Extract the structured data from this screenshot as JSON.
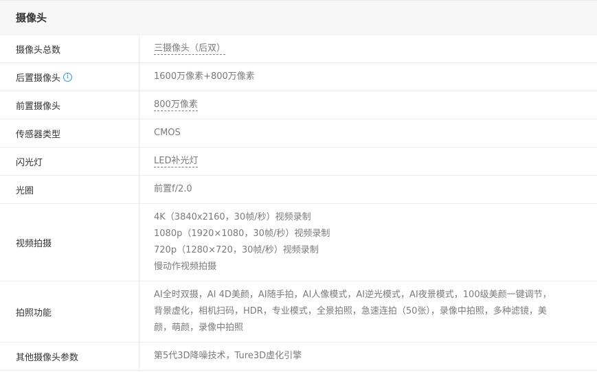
{
  "section": {
    "title": "摄像头"
  },
  "rows": [
    {
      "label": "摄像头总数",
      "value": "三摄像头（后双）"
    },
    {
      "label": "后置摄像头",
      "value": "1600万像素+800万像素",
      "icon": "info-icon"
    },
    {
      "label": "前置摄像头",
      "value": "800万像素"
    },
    {
      "label": "传感器类型",
      "value": "CMOS"
    },
    {
      "label": "闪光灯",
      "value": "LED补光灯"
    },
    {
      "label": "光圈",
      "value": "前置f/2.0"
    },
    {
      "label": "视频拍摄",
      "lines": [
        "4K（3840x2160，30帧/秒）视频录制",
        "1080p（1920×1080，30帧/秒）视频录制",
        "720p（1280×720，30帧/秒）视频录制",
        "慢动作视频拍摄"
      ]
    },
    {
      "label": "拍照功能",
      "lines": [
        "AI全时双摄，AI 4D美颜，AI随手拍，AI人像模式，AI逆光模式，AI夜景模式，100级美颜一键调节，",
        "背景虚化，相机扫码，HDR，专业模式，全景拍照，急速连拍（50张），录像中拍照，多种滤镜，美",
        "颜，萌颜，录像中拍照"
      ]
    },
    {
      "label": "其他摄像头参数",
      "value": "第5代3D降噪技术，Ture3D虚化引擎"
    }
  ],
  "info_icon_glyph": "i"
}
